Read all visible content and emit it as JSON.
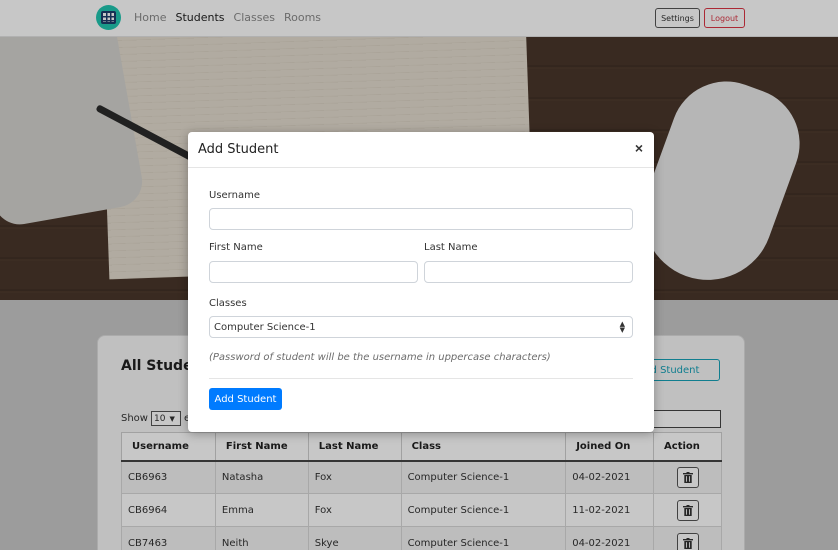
{
  "navbar": {
    "links": [
      "Home",
      "Students",
      "Classes",
      "Rooms"
    ],
    "active": "Students",
    "settings_label": "Settings",
    "logout_label": "Logout"
  },
  "card": {
    "title": "All Studen",
    "add_button_label": "d Student",
    "show_label": "Show",
    "show_value": "10",
    "entries_label": "er"
  },
  "table": {
    "headers": [
      "Username",
      "First Name",
      "Last Name",
      "Class",
      "Joined On",
      "Action"
    ],
    "rows": [
      [
        "CB6963",
        "Natasha",
        "Fox",
        "Computer Science-1",
        "04-02-2021"
      ],
      [
        "CB6964",
        "Emma",
        "Fox",
        "Computer Science-1",
        "11-02-2021"
      ],
      [
        "CB7463",
        "Neith",
        "Skye",
        "Computer Science-1",
        "04-02-2021"
      ]
    ]
  },
  "modal": {
    "title": "Add Student",
    "close_symbol": "×",
    "username_label": "Username",
    "first_name_label": "First Name",
    "last_name_label": "Last Name",
    "classes_label": "Classes",
    "classes_selected": "Computer Science-1",
    "note": "(Password of student will be the username in uppercase characters)",
    "submit_label": "Add Student"
  }
}
